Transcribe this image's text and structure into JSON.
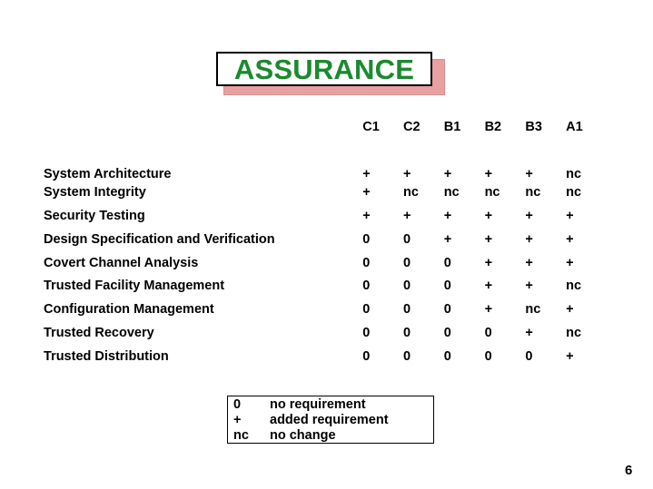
{
  "slide": {
    "title": "ASSURANCE",
    "title_color": "#1a8a2e",
    "title_shadow_color": "#e8a0a0",
    "background_color": "#ffffff",
    "page_number": "6"
  },
  "table": {
    "row_header_label": "",
    "columns": [
      "C1",
      "C2",
      "B1",
      "B2",
      "B3",
      "A1"
    ],
    "rows": [
      {
        "label": "System Architecture",
        "values": [
          "+",
          "+",
          "+",
          "+",
          "+",
          "nc"
        ]
      },
      {
        "label": "System Integrity",
        "values": [
          "+",
          "nc",
          "nc",
          "nc",
          "nc",
          "nc"
        ]
      },
      {
        "label": "Security Testing",
        "values": [
          "+",
          "+",
          "+",
          "+",
          "+",
          "+"
        ]
      },
      {
        "label": "Design Specification and Verification",
        "values": [
          "0",
          "0",
          "+",
          "+",
          "+",
          "+"
        ]
      },
      {
        "label": "Covert Channel Analysis",
        "values": [
          "0",
          "0",
          "0",
          "+",
          "+",
          "+"
        ]
      },
      {
        "label": "Trusted Facility Management",
        "values": [
          "0",
          "0",
          "0",
          "+",
          "+",
          "nc"
        ]
      },
      {
        "label": "Configuration Management",
        "values": [
          "0",
          "0",
          "0",
          "+",
          "nc",
          "+"
        ]
      },
      {
        "label": "Trusted Recovery",
        "values": [
          "0",
          "0",
          "0",
          "0",
          "+",
          "nc"
        ]
      },
      {
        "label": "Trusted Distribution",
        "values": [
          "0",
          "0",
          "0",
          "0",
          "0",
          "+"
        ]
      }
    ]
  },
  "legend": {
    "entries": [
      {
        "symbol": "0",
        "description": "no requirement"
      },
      {
        "symbol": "+",
        "description": "added requirement"
      },
      {
        "symbol": "nc",
        "description": "no change"
      }
    ]
  }
}
